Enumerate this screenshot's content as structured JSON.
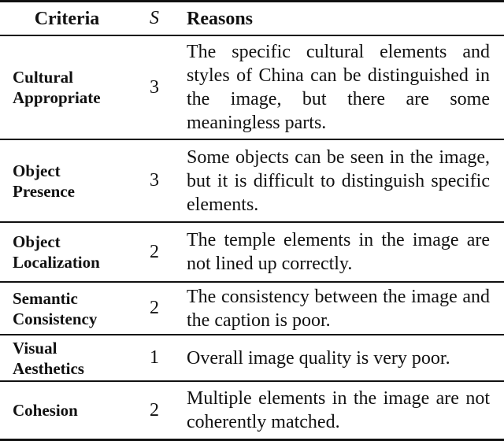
{
  "table": {
    "headers": {
      "criteria": "Criteria",
      "score": "S",
      "reasons": "Reasons"
    },
    "rows": [
      {
        "criteria_line1": "Cultural",
        "criteria_line2": "Appropriate",
        "score": "3",
        "reason": "The specific cultural elements and styles of China can be distinguished in the image, but there are some meaningless parts."
      },
      {
        "criteria_line1": "Object",
        "criteria_line2": "Presence",
        "score": "3",
        "reason": "Some objects can be seen in the im­age, but it is difficult to distinguish specific elements."
      },
      {
        "criteria_line1": "Object",
        "criteria_line2": "Localization",
        "score": "2",
        "reason": "The temple elements in the image are not lined up correctly."
      },
      {
        "criteria_line1": "Semantic",
        "criteria_line2": "Consistency",
        "score": "2",
        "reason": "The consistency between the image and the caption is poor."
      },
      {
        "criteria_line1": "Visual",
        "criteria_line2": "Aesthetics",
        "score": "1",
        "reason": "Overall image quality is very poor."
      },
      {
        "criteria_line1": "Cohesion",
        "criteria_line2": "",
        "score": "2",
        "reason": "Multiple elements in the image are not coherently matched."
      }
    ]
  }
}
